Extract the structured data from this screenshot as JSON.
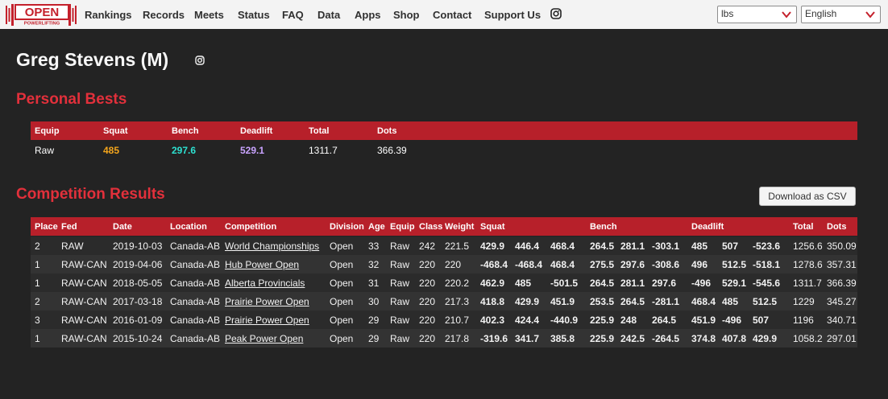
{
  "colors": {
    "background": "#232323",
    "accent_red": "#e2303b",
    "header_red": "#b7202a",
    "squat": "#f4a51c",
    "bench": "#2de0d0",
    "deadlift": "#c9a3ff"
  },
  "nav": {
    "logo_line1": "OPEN",
    "logo_line2": "POWERLIFTING",
    "links": [
      "Rankings",
      "Records",
      "Meets",
      "Status",
      "FAQ",
      "Data",
      "Apps",
      "Shop",
      "Contact",
      "Support Us"
    ],
    "instagram_icon": "instagram-icon",
    "unit_select": "lbs",
    "language_select": "English"
  },
  "lifter": {
    "name": "Greg Stevens (M)",
    "instagram_icon": "instagram-icon"
  },
  "personal_bests": {
    "title": "Personal Bests",
    "headers": [
      "Equip",
      "Squat",
      "Bench",
      "Deadlift",
      "Total",
      "Dots"
    ],
    "row": [
      "Raw",
      "485",
      "297.6",
      "529.1",
      "1311.7",
      "366.39"
    ]
  },
  "competition": {
    "title": "Competition Results",
    "csv_button": "Download as CSV",
    "headers": [
      "Place",
      "Fed",
      "Date",
      "Location",
      "Competition",
      "Division",
      "Age",
      "Equip",
      "Class",
      "Weight",
      "Squat",
      "Bench",
      "Deadlift",
      "Total",
      "Dots"
    ],
    "rows": [
      {
        "place": "2",
        "fed": "RAW",
        "date": "2019-10-03",
        "location": "Canada-AB",
        "competition": "World Championships",
        "division": "Open",
        "age": "33",
        "equip": "Raw",
        "class": "242",
        "weight": "221.5",
        "squat": [
          "429.9",
          "446.4",
          "468.4"
        ],
        "bench": [
          "264.5",
          "281.1",
          "-303.1"
        ],
        "deadlift": [
          "485",
          "507",
          "-523.6"
        ],
        "total": "1256.6",
        "dots": "350.09"
      },
      {
        "place": "1",
        "fed": "RAW-CAN",
        "date": "2019-04-06",
        "location": "Canada-AB",
        "competition": "Hub Power Open",
        "division": "Open",
        "age": "32",
        "equip": "Raw",
        "class": "220",
        "weight": "220",
        "squat": [
          "-468.4",
          "-468.4",
          "468.4"
        ],
        "bench": [
          "275.5",
          "297.6",
          "-308.6"
        ],
        "deadlift": [
          "496",
          "512.5",
          "-518.1"
        ],
        "total": "1278.6",
        "dots": "357.31"
      },
      {
        "place": "1",
        "fed": "RAW-CAN",
        "date": "2018-05-05",
        "location": "Canada-AB",
        "competition": "Alberta Provincials",
        "division": "Open",
        "age": "31",
        "equip": "Raw",
        "class": "220",
        "weight": "220.2",
        "squat": [
          "462.9",
          "485",
          "-501.5"
        ],
        "bench": [
          "264.5",
          "281.1",
          "297.6"
        ],
        "deadlift": [
          "-496",
          "529.1",
          "-545.6"
        ],
        "total": "1311.7",
        "dots": "366.39"
      },
      {
        "place": "2",
        "fed": "RAW-CAN",
        "date": "2017-03-18",
        "location": "Canada-AB",
        "competition": "Prairie Power Open",
        "division": "Open",
        "age": "30",
        "equip": "Raw",
        "class": "220",
        "weight": "217.3",
        "squat": [
          "418.8",
          "429.9",
          "451.9"
        ],
        "bench": [
          "253.5",
          "264.5",
          "-281.1"
        ],
        "deadlift": [
          "468.4",
          "485",
          "512.5"
        ],
        "total": "1229",
        "dots": "345.27"
      },
      {
        "place": "3",
        "fed": "RAW-CAN",
        "date": "2016-01-09",
        "location": "Canada-AB",
        "competition": "Prairie Power Open",
        "division": "Open",
        "age": "29",
        "equip": "Raw",
        "class": "220",
        "weight": "210.7",
        "squat": [
          "402.3",
          "424.4",
          "-440.9"
        ],
        "bench": [
          "225.9",
          "248",
          "264.5"
        ],
        "deadlift": [
          "451.9",
          "-496",
          "507"
        ],
        "total": "1196",
        "dots": "340.71"
      },
      {
        "place": "1",
        "fed": "RAW-CAN",
        "date": "2015-10-24",
        "location": "Canada-AB",
        "competition": "Peak Power Open",
        "division": "Open",
        "age": "29",
        "equip": "Raw",
        "class": "220",
        "weight": "217.8",
        "squat": [
          "-319.6",
          "341.7",
          "385.8"
        ],
        "bench": [
          "225.9",
          "242.5",
          "-264.5"
        ],
        "deadlift": [
          "374.8",
          "407.8",
          "429.9"
        ],
        "total": "1058.2",
        "dots": "297.01"
      }
    ]
  }
}
